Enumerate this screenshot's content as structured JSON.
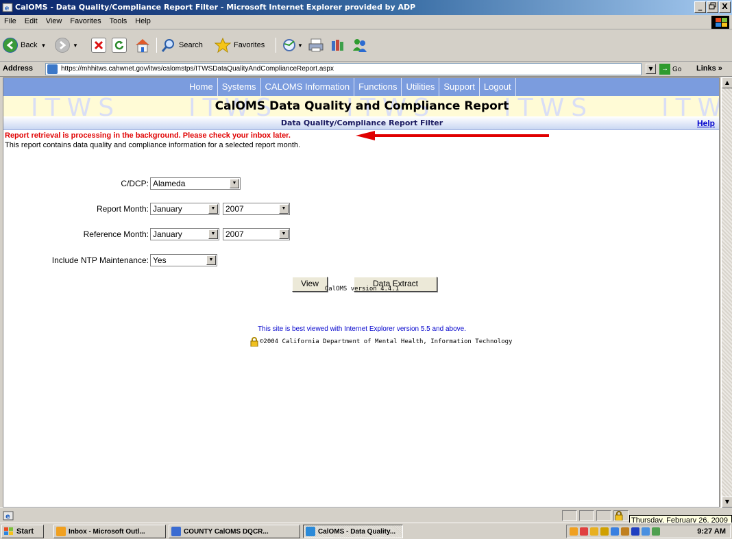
{
  "window": {
    "title": "CalOMS - Data Quality/Compliance Report Filter - Microsoft Internet Explorer provided by ADP",
    "buttons": [
      "_",
      "Θ",
      "X"
    ]
  },
  "menu": [
    "File",
    "Edit",
    "View",
    "Favorites",
    "Tools",
    "Help"
  ],
  "toolbar": {
    "back": "Back",
    "search": "Search",
    "favorites": "Favorites"
  },
  "address": {
    "label": "Address",
    "url": "https://mhhitws.cahwnet.gov/itws/calomstps/ITWSDataQualityAndComplianceReport.aspx",
    "go": "Go",
    "links": "Links »"
  },
  "nav": [
    "Home",
    "Systems",
    "CALOMS Information",
    "Functions",
    "Utilities",
    "Support",
    "Logout"
  ],
  "banner": {
    "watermark": [
      "ITWS",
      "ITWS",
      "ITWS",
      "ITWS",
      "ITW"
    ],
    "title": "CalOMS Data Quality and Compliance Report"
  },
  "subheader": {
    "title": "Data Quality/Compliance Report Filter",
    "help": "Help"
  },
  "messages": {
    "processing": "Report retrieval is processing in the background. Please check your inbox later.",
    "description": "This report contains data quality and compliance information for a selected report month."
  },
  "form": {
    "cdcp_label": "C/DCP:",
    "cdcp_value": "Alameda",
    "report_month_label": "Report Month:",
    "report_month_value": "January",
    "report_year_value": "2007",
    "reference_month_label": "Reference Month:",
    "reference_month_value": "January",
    "reference_year_value": "2007",
    "ntp_label": "Include NTP Maintenance:",
    "ntp_value": "Yes",
    "view_button": "View",
    "extract_button": "Data Extract"
  },
  "footer": {
    "version": "CalOMS version 4.4.1",
    "best_viewed": "This site is best viewed with Internet Explorer version 5.5 and above.",
    "copyright": "©2004 California Department of Mental Health, Information Technology"
  },
  "status": {
    "tooltip": "Thursday, February 26, 2009"
  },
  "taskbar": {
    "start": "Start",
    "tasks": [
      "Inbox - Microsoft Outl...",
      "COUNTY CalOMS DQCR...",
      "CalOMS - Data Quality..."
    ],
    "clock": "9:27 AM"
  },
  "colors": {
    "nav_bg": "#7b9cde",
    "banner_bg": "#fffbd6",
    "alert_red": "#e00000",
    "link_blue": "#0000cc"
  }
}
